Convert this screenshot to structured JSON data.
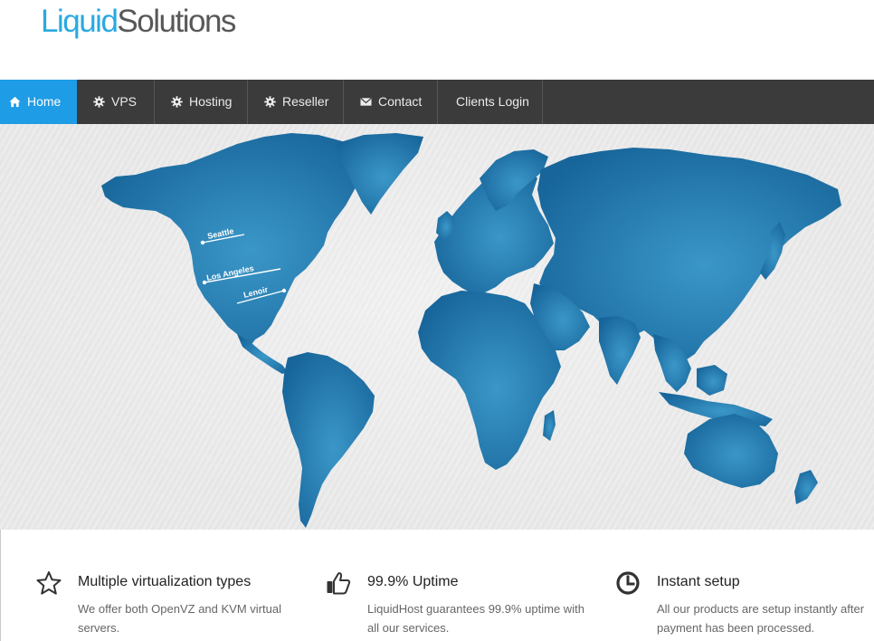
{
  "brand": {
    "part1": "Liquid",
    "part2": "Solutions"
  },
  "nav": {
    "items": [
      {
        "label": "Home",
        "icon": "home-icon",
        "active": true
      },
      {
        "label": "VPS",
        "icon": "gear-icon"
      },
      {
        "label": "Hosting",
        "icon": "gear-icon"
      },
      {
        "label": "Reseller",
        "icon": "gear-icon"
      },
      {
        "label": "Contact",
        "icon": "envelope-icon"
      },
      {
        "label": "Clients Login"
      }
    ]
  },
  "map": {
    "locations": [
      "Seattle",
      "Los Angeles",
      "Lenoir"
    ],
    "colors": {
      "land": "#1c77ad",
      "land_light": "#3b97c8",
      "background": "#e9e9e9"
    }
  },
  "features": [
    {
      "icon": "star-outline-icon",
      "title": "Multiple virtualization types",
      "text": "We offer both OpenVZ and KVM virtual servers."
    },
    {
      "icon": "thumbs-up-icon",
      "title": "99.9% Uptime",
      "text": "LiquidHost guarantees 99.9% uptime with all our services."
    },
    {
      "icon": "clock-icon",
      "title": "Instant setup",
      "text": "All our products are setup instantly after payment has been processed."
    }
  ],
  "colors": {
    "accent": "#1e9ce6",
    "nav_bg": "#3b3b3b",
    "logo_blue": "#29a9e0",
    "logo_gray": "#585858"
  }
}
